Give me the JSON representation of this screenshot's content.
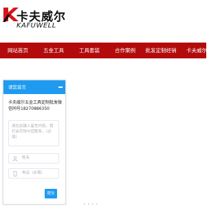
{
  "brand": {
    "name_cn": "卡夫威尔",
    "name_en": "KAFUWELL",
    "logo_icon": "kafuwell-k-logo-icon"
  },
  "nav": {
    "items": [
      {
        "label": "网站首页"
      },
      {
        "label": "五金工具"
      },
      {
        "label": "工具套装"
      },
      {
        "label": "合作案例"
      },
      {
        "label": "批发定制经销"
      },
      {
        "label": "卡夫威尔"
      }
    ]
  },
  "chat": {
    "title": "请您留言",
    "message": "卡夫威尔五金工具定制批发微信同号18270886350",
    "textarea_placeholder": "请在此输入留言内容，我们会尽快与您联系。（必填）",
    "name_placeholder": "姓名",
    "phone_placeholder": "电话（必填）",
    "send_label": "提交",
    "minimize_icon": "minus-icon",
    "user_icon": "user-icon",
    "phone_icon": "phone-icon"
  },
  "colors": {
    "nav_bg": "#b30b0b",
    "chat_accent": "#1e9bf0",
    "logo_red": "#d7141a"
  }
}
